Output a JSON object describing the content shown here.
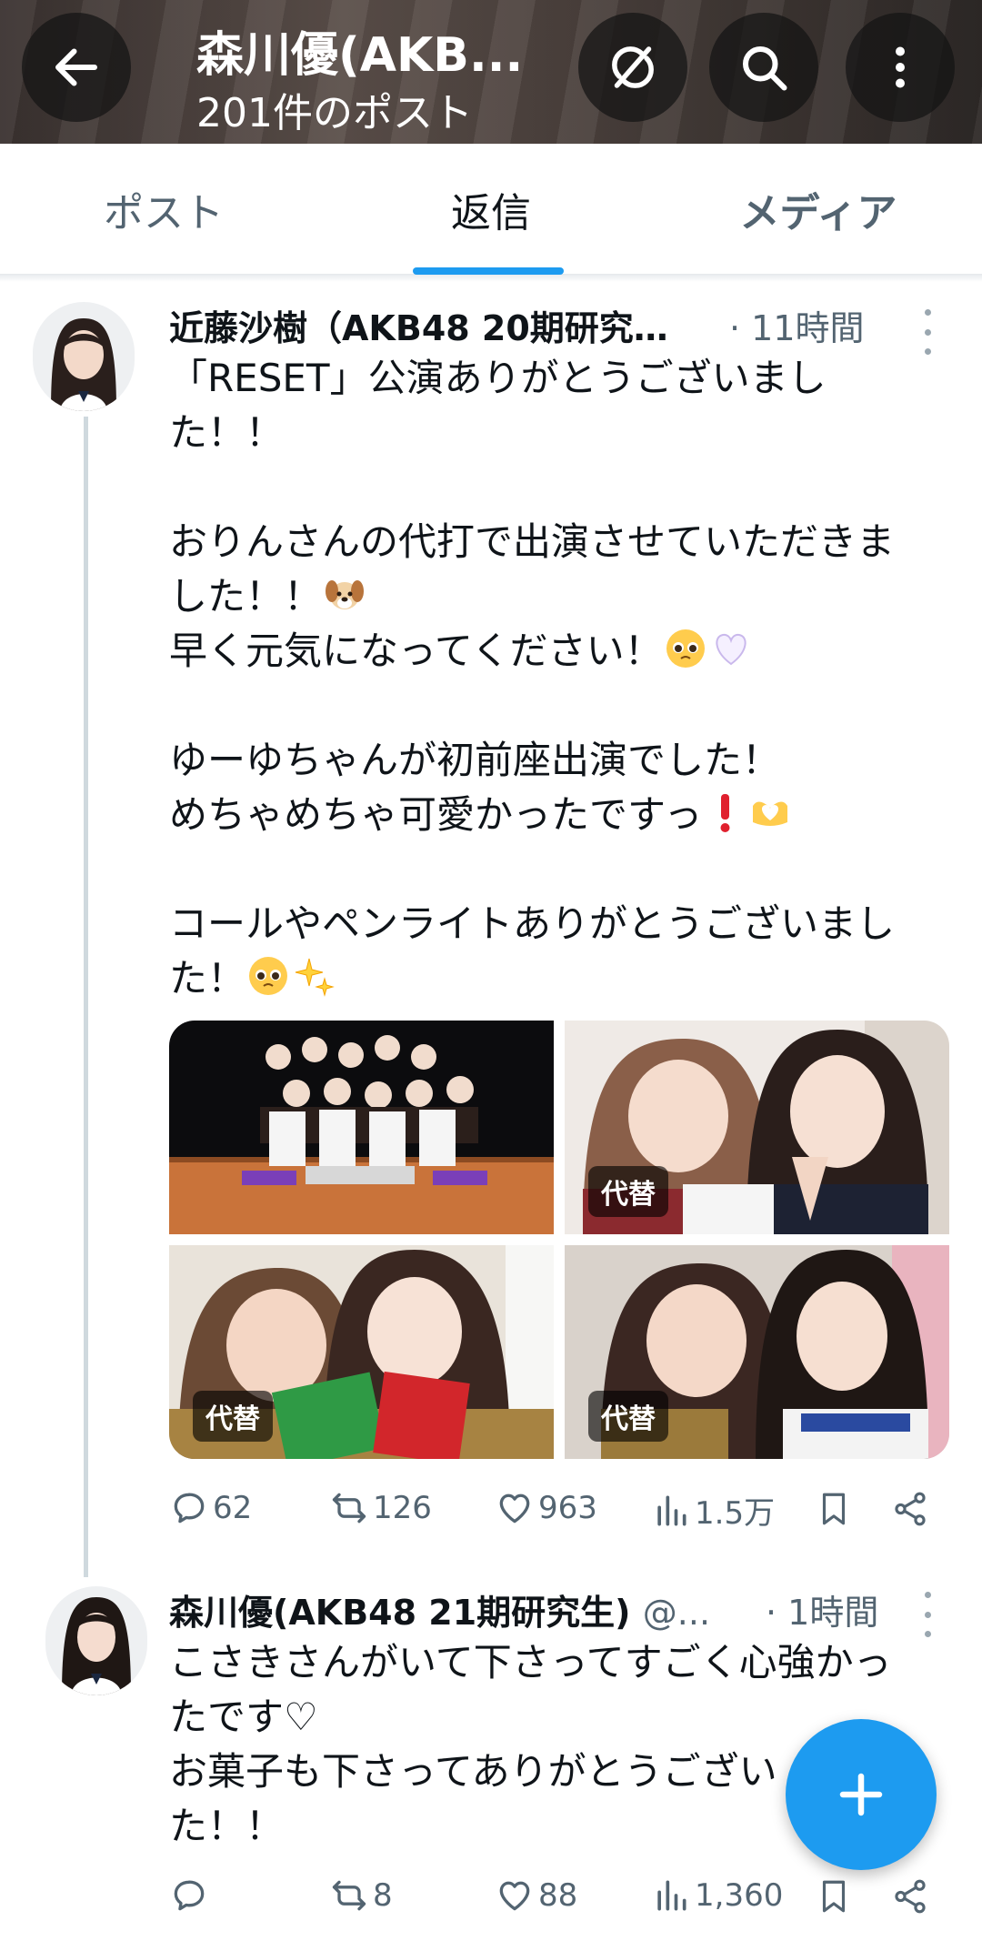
{
  "header": {
    "title": "森川優(AKB...",
    "post_count": "201件のポスト",
    "icons": [
      "back-arrow-icon",
      "sync-off-icon",
      "search-icon",
      "more-vertical-icon"
    ]
  },
  "tabs": [
    {
      "label": "ポスト"
    },
    {
      "label": "返信"
    },
    {
      "label": "メディア"
    }
  ],
  "posts": [
    {
      "author": "近藤沙樹（AKB48 20期研究…",
      "time": "· 11時間",
      "lines": [
        "「RESET」公演ありがとうございまし",
        "た！！",
        "",
        "おりんさんの代打で出演させていただきま",
        "した！！",
        "早く元気になってください！",
        "",
        "ゆーゆちゃんが初前座出演でした！",
        "めちゃめちゃ可愛かったですっ",
        "",
        "コールやペンライトありがとうございまし",
        "た！"
      ],
      "media_alt_label": "代替",
      "stats": {
        "replies": "62",
        "reposts": "126",
        "likes": "963",
        "views": "1.5万"
      }
    },
    {
      "author": "森川優(AKB48 21期研究生)",
      "handle": "@...",
      "time": "· 1時間",
      "lines": [
        "こさきさんがいて下さってすごく心強かっ",
        "たです♡",
        "お菓子も下さってありがとうござい",
        "た！！"
      ],
      "stats": {
        "replies": "",
        "reposts": "8",
        "likes": "88",
        "views": "1,360"
      }
    }
  ],
  "colors": {
    "accent": "#1d9bf0",
    "text": "#0f1419",
    "muted": "#536471"
  }
}
